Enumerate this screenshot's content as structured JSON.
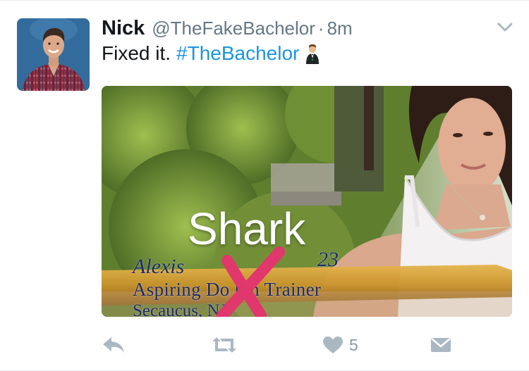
{
  "tweet": {
    "author_name": "Nick",
    "handle": "@TheFakeBachelor",
    "separator": "·",
    "time": "8m",
    "text": "Fixed it.",
    "hashtag": "#TheBachelor",
    "emoji": "man-in-tuxedo-emoji"
  },
  "media": {
    "overlay_name": "Alexis",
    "overlay_age": "23",
    "overlay_occupation": "Aspiring Do     hin Trainer",
    "overlay_location": "Secaucus, NJ",
    "edit_text": "Shark",
    "edit_mark": "x-mark"
  },
  "actions": {
    "reply_icon": "reply-icon",
    "retweet_icon": "retweet-icon",
    "like_icon": "heart-icon",
    "like_count": "5",
    "dm_icon": "envelope-icon"
  },
  "colors": {
    "hashtag": "#1b95e0",
    "secondary_text": "#657786",
    "action_icon": "#aab8c2",
    "edit_mark": "#e0376c"
  }
}
